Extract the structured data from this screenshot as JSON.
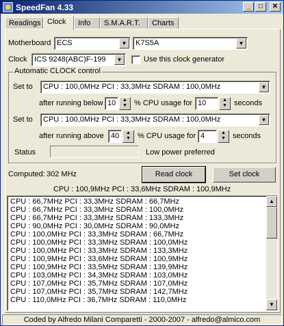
{
  "window": {
    "title": "SpeedFan 4.33",
    "min_glyph": "_",
    "max_glyph": "□",
    "close_glyph": "✕"
  },
  "tabs": [
    {
      "label": "Readings"
    },
    {
      "label": "Clock"
    },
    {
      "label": "Info"
    },
    {
      "label": "S.M.A.R.T."
    },
    {
      "label": "Charts"
    }
  ],
  "motherboard": {
    "label": "Motherboard",
    "vendor": "ECS",
    "model": "K7S5A"
  },
  "clock": {
    "label": "Clock",
    "value": "ICS 9248(ABC)F-199",
    "use_generator_label": "Use this clock generator",
    "use_generator_checked": false
  },
  "auto_control": {
    "legend": "Automatic CLOCK control",
    "set_to_1": {
      "label": "Set to",
      "value": "CPU : 100,0MHz  PCI : 33,3MHz  SDRAM : 100,0MHz"
    },
    "below": {
      "label": "after running below",
      "percent": "10",
      "usage_label": "% CPU usage for",
      "seconds": "10",
      "seconds_label": "seconds"
    },
    "set_to_2": {
      "label": "Set to",
      "value": "CPU : 100,0MHz  PCI : 33,3MHz  SDRAM : 100,0MHz"
    },
    "above": {
      "label": "after running above",
      "percent": "40",
      "usage_label": "% CPU usage for",
      "seconds": "4",
      "seconds_label": "seconds"
    },
    "status_label": "Status",
    "status_value": "",
    "low_power": "Low power preferred"
  },
  "computed": {
    "label": "Computed:",
    "value": "302 MHz"
  },
  "buttons": {
    "read_clock": "Read clock",
    "set_clock": "Set clock"
  },
  "current_clock": "CPU : 100,9MHz  PCI : 33,6MHz  SDRAM : 100,9MHz",
  "clock_list": [
    "CPU : 66,7MHz  PCI : 33,3MHz  SDRAM : 66,7MHz",
    "CPU : 66,7MHz  PCI : 33,3MHz  SDRAM : 100,0MHz",
    "CPU : 66,7MHz  PCI : 33,3MHz  SDRAM : 133,3MHz",
    "CPU : 90,0MHz  PCI : 30,0MHz  SDRAM : 90,0MHz",
    "CPU : 100,0MHz  PCI : 33,3MHz  SDRAM : 66,7MHz",
    "CPU : 100,0MHz  PCI : 33,3MHz  SDRAM : 100,0MHz",
    "CPU : 100,0MHz  PCI : 33,3MHz  SDRAM : 133,3MHz",
    "CPU : 100,9MHz  PCI : 33,6MHz  SDRAM : 100,9MHz",
    "CPU : 100,9MHz  PCI : 33,5MHz  SDRAM : 139,9MHz",
    "CPU : 103,0MHz  PCI : 34,3MHz  SDRAM : 103,0MHz",
    "CPU : 107,0MHz  PCI : 35,7MHz  SDRAM : 107,0MHz",
    "CPU : 107,0MHz  PCI : 35,7MHz  SDRAM : 142,7MHz",
    "CPU : 110,0MHz  PCI : 36,7MHz  SDRAM : 110,0MHz"
  ],
  "status_bar": "Coded by Alfredo Milani Comparetti - 2000-2007 - alfredo@almico.com",
  "icons": {
    "dropdown": "▼",
    "spin_up": "▲",
    "spin_down": "▼",
    "scroll_up": "▲",
    "scroll_down": "▼"
  },
  "colors": {
    "title_gradient_start": "#0a246a",
    "title_gradient_end": "#a6caf0",
    "face": "#ece9d8"
  }
}
